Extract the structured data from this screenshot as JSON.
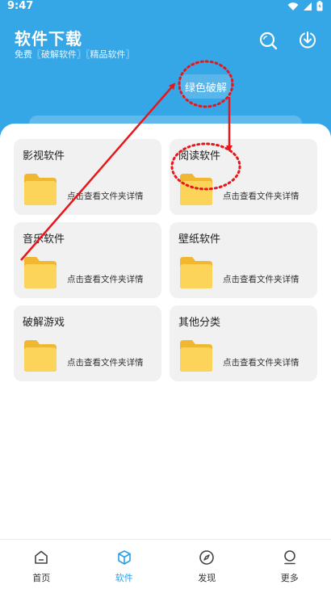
{
  "status_bar": {
    "time": "9:47"
  },
  "header": {
    "title": "软件下载",
    "subtitle": "免费〖破解软件〗〖精品软件〗",
    "search_icon": "search-icon",
    "download_icon": "download-icon"
  },
  "chip": {
    "label": "绿色破解"
  },
  "cards": [
    {
      "title": "影视软件",
      "desc": "点击查看文件夹详情"
    },
    {
      "title": "阅读软件",
      "desc": "点击查看文件夹详情"
    },
    {
      "title": "音乐软件",
      "desc": "点击查看文件夹详情"
    },
    {
      "title": "壁纸软件",
      "desc": "点击查看文件夹详情"
    },
    {
      "title": "破解游戏",
      "desc": "点击查看文件夹详情"
    },
    {
      "title": "其他分类",
      "desc": "点击查看文件夹详情"
    }
  ],
  "bottom_nav": [
    {
      "label": "首页",
      "icon": "home-icon"
    },
    {
      "label": "软件",
      "icon": "cube-icon",
      "active": true
    },
    {
      "label": "发现",
      "icon": "compass-icon"
    },
    {
      "label": "更多",
      "icon": "person-icon"
    }
  ],
  "colors": {
    "header": "#35a6e6",
    "accent": "#2aa0e6",
    "folder": "#fdd45a",
    "annotation": "#e8161b"
  }
}
